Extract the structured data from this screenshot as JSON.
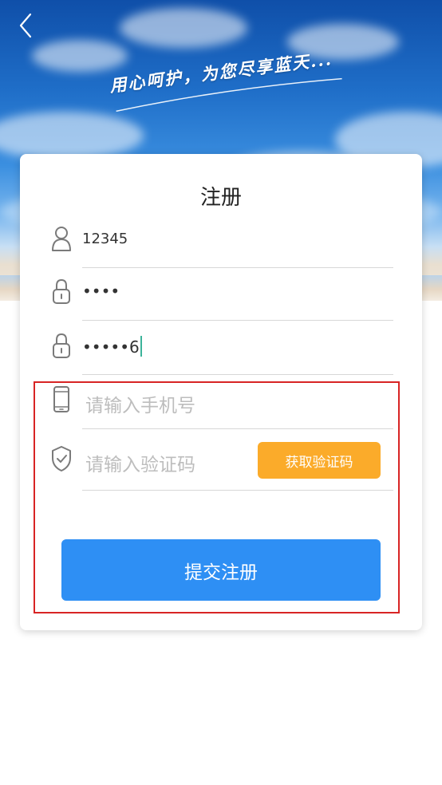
{
  "header": {
    "back_icon": "chevron-left-icon",
    "slogan": "用心呵护，为您尽享蓝天..."
  },
  "form": {
    "title": "注册",
    "username": {
      "icon": "user-icon",
      "value": "12345"
    },
    "password": {
      "icon": "lock-icon",
      "value": "••••"
    },
    "confirm_password": {
      "icon": "lock-icon",
      "value": "•••••6"
    },
    "phone": {
      "icon": "phone-icon",
      "placeholder": "请输入手机号"
    },
    "code": {
      "icon": "shield-check-icon",
      "placeholder": "请输入验证码"
    },
    "get_code_label": "获取验证码",
    "submit_label": "提交注册"
  },
  "colors": {
    "accent_blue": "#2e8ff4",
    "accent_orange": "#fbab2a",
    "highlight_red": "#d82424",
    "caret": "#3cb39a"
  }
}
